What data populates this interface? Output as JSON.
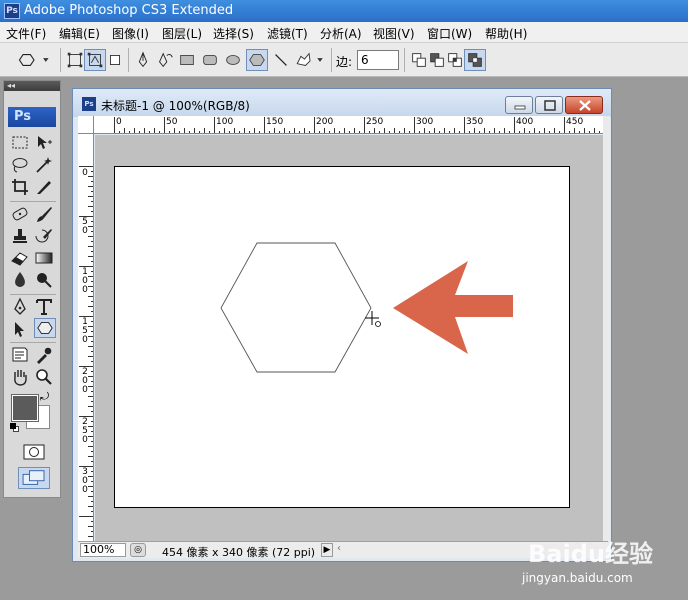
{
  "app": {
    "title": "Adobe Photoshop CS3 Extended",
    "logo": "Ps"
  },
  "menu": [
    "文件(F)",
    "编辑(E)",
    "图像(I)",
    "图层(L)",
    "选择(S)",
    "滤镜(T)",
    "分析(A)",
    "视图(V)",
    "窗口(W)",
    "帮助(H)"
  ],
  "options": {
    "sides_label": "边:",
    "sides_value": "6"
  },
  "toolbox": {
    "logo": "Ps",
    "foreground_color": "#5b5b5b",
    "background_color": "#ffffff"
  },
  "document": {
    "title": "未标题-1 @ 100%(RGB/8)",
    "ruler_x": [
      "0",
      "50",
      "100",
      "150",
      "200",
      "250",
      "300",
      "350",
      "400",
      "450"
    ],
    "ruler_y": [
      "0",
      "5 0",
      "1 0 0",
      "1 5 0",
      "2 0 0",
      "2 5 0",
      "3 0 0"
    ],
    "zoom": "100%",
    "status": "454 像素 x 340 像素 (72 ppi)",
    "arrow_color": "#d9654a"
  },
  "watermark": {
    "brand": "Baidu经验",
    "site": "jingyan.baidu.com"
  }
}
